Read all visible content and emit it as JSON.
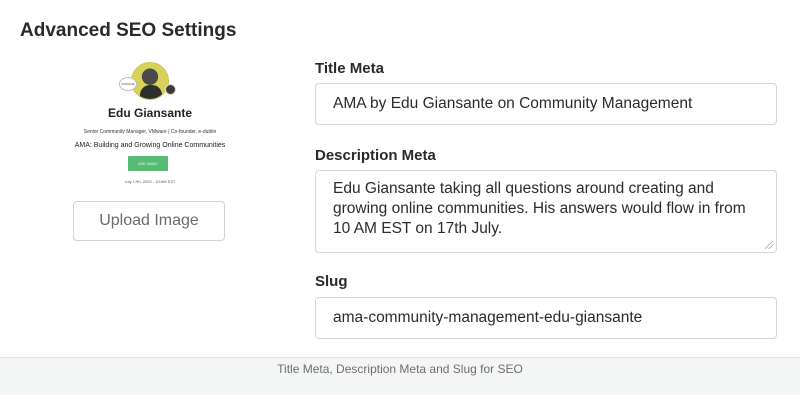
{
  "section": {
    "title": "Advanced SEO Settings"
  },
  "preview": {
    "name": "Edu Giansante",
    "role": "Senior Community Manager, VMware | Co-founder, e-dublin",
    "event": "AMA: Building and Growing Online Communities",
    "button": "ASK AWAY",
    "date": "July 17th, 2020 - 10 AM EST",
    "badge": "VMWARE"
  },
  "upload": {
    "label": "Upload Image"
  },
  "fields": {
    "title_meta": {
      "label": "Title Meta",
      "value": "AMA by Edu Giansante on Community Management"
    },
    "description_meta": {
      "label": "Description Meta",
      "value": "Edu Giansante taking all questions around creating and growing online communities. His answers would flow in from 10 AM EST on 17th July."
    },
    "slug": {
      "label": "Slug",
      "value": "ama-community-management-edu-giansante"
    }
  },
  "caption": "Title Meta, Description Meta and Slug for SEO",
  "colors": {
    "button_green": "#58bb73",
    "border": "#d3d7d9",
    "background": "#f4f6f6"
  }
}
